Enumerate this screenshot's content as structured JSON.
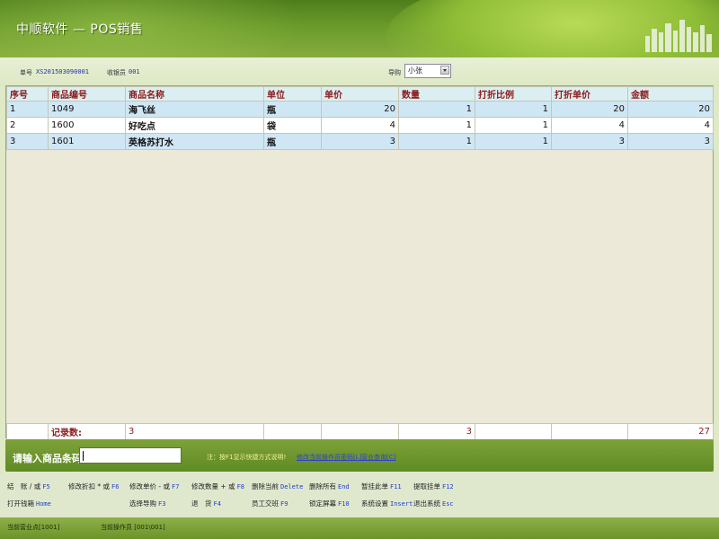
{
  "app": {
    "title": "中顺软件 — POS销售"
  },
  "header": {
    "order_no_label": "单号",
    "order_no": "XS201503090001",
    "cashier_label": "收银员",
    "cashier": "001",
    "guide_label": "导购",
    "guide_value": "小张"
  },
  "grid": {
    "columns": [
      "序号",
      "商品编号",
      "商品名称",
      "单位",
      "单价",
      "数量",
      "打折比例",
      "打折单价",
      "金额"
    ],
    "rows": [
      {
        "seq": "1",
        "code": "1049",
        "name": "海飞丝",
        "unit": "瓶",
        "price": "20",
        "qty": "1",
        "discount": "1",
        "disc_price": "20",
        "amount": "20"
      },
      {
        "seq": "2",
        "code": "1600",
        "name": "好吃点",
        "unit": "袋",
        "price": "4",
        "qty": "1",
        "discount": "1",
        "disc_price": "4",
        "amount": "4"
      },
      {
        "seq": "3",
        "code": "1601",
        "name": "英格苏打水",
        "unit": "瓶",
        "price": "3",
        "qty": "1",
        "discount": "1",
        "disc_price": "3",
        "amount": "3"
      }
    ],
    "footer": {
      "label": "记录数:",
      "count": "3",
      "total_qty": "3",
      "total_amount": "27"
    }
  },
  "barcode": {
    "label": "请输入商品条码",
    "value": "",
    "hint": "注：按F1显示快捷方式说明!",
    "link1": "修改当前操作员密码[L]",
    "link2": "营业查询[C]"
  },
  "shortcuts": [
    {
      "label": "结　账 / 或",
      "key": "F5"
    },
    {
      "label": "修改折扣 * 或",
      "key": "F6"
    },
    {
      "label": "修改单价 - 或",
      "key": "F7"
    },
    {
      "label": "修改数量 + 或",
      "key": "F8"
    },
    {
      "label": "删除当前",
      "key": "Delete"
    },
    {
      "label": "删除所有",
      "key": "End"
    },
    {
      "label": "暂挂此单",
      "key": "F11"
    },
    {
      "label": "提取挂单",
      "key": "F12"
    },
    {
      "label": "打开钱箱",
      "key": "Home"
    },
    {
      "label": "选择导购",
      "key": "F3"
    },
    {
      "label": "退　货",
      "key": "F4"
    },
    {
      "label": "员工交班",
      "key": "F9"
    },
    {
      "label": "锁定屏幕",
      "key": "F10"
    },
    {
      "label": "系统设置",
      "key": "Insert"
    },
    {
      "label": "退出系统",
      "key": "Esc"
    }
  ],
  "status": {
    "store": "当前营业点[1001]",
    "operator": "当前操作员 [001\\001]"
  },
  "colors": {
    "accent_green": "#6a9428",
    "header_text": "#8b1a1a",
    "link_blue": "#2d3fd1"
  }
}
